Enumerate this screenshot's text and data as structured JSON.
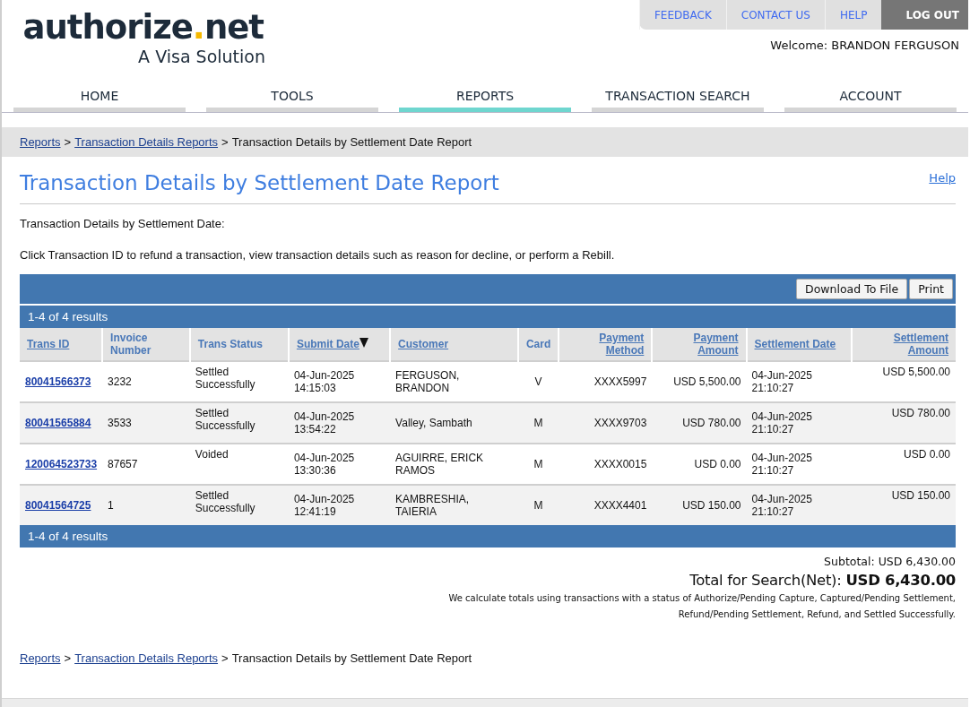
{
  "logo": {
    "word": "authorize",
    "dot": ".",
    "suffix": "net",
    "tagline": "A Visa Solution"
  },
  "top_links": [
    {
      "label": "FEEDBACK",
      "kind": "link"
    },
    {
      "label": "CONTACT US",
      "kind": "link"
    },
    {
      "label": "HELP",
      "kind": "link"
    },
    {
      "label": "LOG OUT",
      "kind": "logout"
    }
  ],
  "welcome": "Welcome: BRANDON FERGUSON",
  "nav_tabs": [
    {
      "label": "HOME",
      "selected": false
    },
    {
      "label": "TOOLS",
      "selected": false
    },
    {
      "label": "REPORTS",
      "selected": true
    },
    {
      "label": "TRANSACTION SEARCH",
      "selected": false
    },
    {
      "label": "ACCOUNT",
      "selected": false
    }
  ],
  "breadcrumb": {
    "separator": ">",
    "items": [
      {
        "label": "Reports",
        "link": true
      },
      {
        "label": "Transaction Details Reports",
        "link": true
      },
      {
        "label": "Transaction Details by Settlement Date Report",
        "link": false
      }
    ]
  },
  "page_title": "Transaction Details by Settlement Date Report",
  "help_link": "Help",
  "subtitle": "Transaction Details by Settlement Date:",
  "instructions": "Click Transaction ID to refund a transaction, view transaction details such as reason for decline, or perform a Rebill.",
  "toolbar_buttons": [
    "Download To File",
    "Print"
  ],
  "results_top": "1-4 of 4 results",
  "table": {
    "columns": [
      {
        "label": "Trans ID",
        "link": true,
        "sorted": false
      },
      {
        "label": "Invoice Number",
        "link": false,
        "sorted": false
      },
      {
        "label": "Trans Status",
        "link": false,
        "sorted": false
      },
      {
        "label": "Submit Date",
        "link": true,
        "sorted": true
      },
      {
        "label": "Customer",
        "link": true,
        "sorted": false
      },
      {
        "label": "Card",
        "link": false,
        "sorted": false
      },
      {
        "label": "Payment Method",
        "link": true,
        "sorted": false
      },
      {
        "label": "Payment Amount",
        "link": true,
        "sorted": false
      },
      {
        "label": "Settlement Date",
        "link": true,
        "sorted": false
      },
      {
        "label": "Settlement Amount",
        "link": true,
        "sorted": false
      }
    ],
    "rows": [
      [
        "80041566373",
        "3232",
        "Settled Successfully",
        "04-Jun-2025 14:15:03",
        "FERGUSON, BRANDON",
        "V",
        "XXXX5997",
        "USD 5,500.00",
        "04-Jun-2025 21:10:27",
        "USD 5,500.00"
      ],
      [
        "80041565884",
        "3533",
        "Settled Successfully",
        "04-Jun-2025 13:54:22",
        "Valley, Sambath",
        "M",
        "XXXX9703",
        "USD 780.00",
        "04-Jun-2025 21:10:27",
        "USD 780.00"
      ],
      [
        "120064523733",
        "87657",
        "Voided",
        "04-Jun-2025 13:30:36",
        "AGUIRRE, ERICK RAMOS",
        "M",
        "XXXX0015",
        "USD 0.00",
        "04-Jun-2025 21:10:27",
        "USD 0.00"
      ],
      [
        "80041564725",
        "1",
        "Settled Successfully",
        "04-Jun-2025 12:41:19",
        "KAMBRESHIA, TAIERIA",
        "M",
        "XXXX4401",
        "USD 150.00",
        "04-Jun-2025 21:10:27",
        "USD 150.00"
      ]
    ]
  },
  "results_bottom": "1-4 of 4 results",
  "subtotal": "Subtotal: USD 6,430.00",
  "total": "Total for Search(Net): **USD 6,430.00**",
  "totals_note": "We calculate totals using transactions with a status of Authorize/Pending Capture, Captured/Pending Settlement, Refund/Pending Settlement, Refund, and Settled Successfully.",
  "footer_breadcrumb": {
    "separator": ">",
    "items": [
      {
        "label": "Reports",
        "link": true
      },
      {
        "label": "Transaction Details Reports",
        "link": true
      },
      {
        "label": "Transaction Details by Settlement Date Report",
        "link": false
      }
    ]
  }
}
